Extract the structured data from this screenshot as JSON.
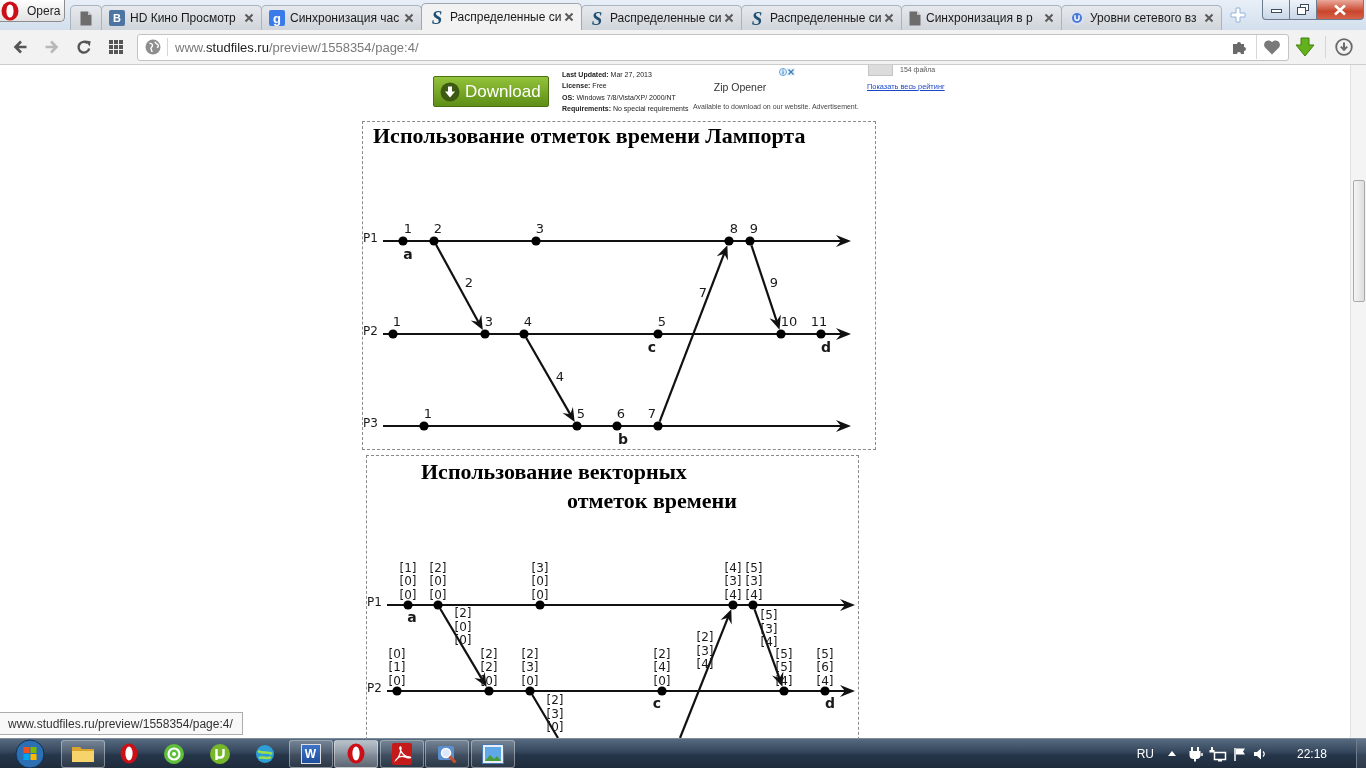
{
  "browser": {
    "menu_button": {
      "label": "Opera"
    },
    "tabs": [
      {
        "selected": false
      },
      {
        "favicon": "B",
        "title": "HD Кино Просмотр",
        "selected": false
      },
      {
        "favicon": "g",
        "title": "Синхронизация час",
        "selected": false
      },
      {
        "favicon": "S",
        "title": "Распределенные си",
        "selected": true
      },
      {
        "favicon": "S",
        "title": "Распределенные си",
        "selected": false
      },
      {
        "favicon": "S",
        "title": "Распределенные си",
        "selected": false
      },
      {
        "title": "Синхронизация в р",
        "selected": false
      },
      {
        "title": "Уровни сетевого вз",
        "selected": false
      }
    ],
    "navigation": {
      "back_disabled": false,
      "forward_disabled": true
    },
    "address": {
      "prefix": "www.",
      "domain": "studfiles.ru",
      "path": "/preview/1558354/page:4/"
    }
  },
  "page": {
    "ad": {
      "button": "Download",
      "details": [
        "**Last Updated:** Mar 27, 2013",
        "**License:** Free",
        "**OS:** Windows 7/8/Vista/XP/ 2000/NT",
        "**Requirements:** No special requirements"
      ],
      "title": "Zip Opener",
      "disclaimer": "Available to download on our website. Advertisement."
    },
    "sidebar": {
      "count": "154 файла",
      "link": "Показать весь рейтинг"
    },
    "slides": [
      {
        "title": [
          "Использование отметок времени Лампорта"
        ],
        "diagram": {
          "processes": [
            {
              "name": "P1",
              "events": [
                {
                  "timestamp": [
                    "1"
                  ],
                  "label": "a"
                },
                {
                  "timestamp": [
                    "2"
                  ]
                },
                {
                  "timestamp": [
                    "3"
                  ]
                },
                {
                  "timestamp": [
                    "8"
                  ]
                },
                {
                  "timestamp": [
                    "9"
                  ]
                }
              ]
            },
            {
              "name": "P2",
              "events": [
                {
                  "timestamp": [
                    "1"
                  ]
                },
                {
                  "timestamp": [
                    "3"
                  ]
                },
                {
                  "timestamp": [
                    "4"
                  ]
                },
                {
                  "timestamp": [
                    "5"
                  ],
                  "label": "c"
                },
                {
                  "timestamp": [
                    "10"
                  ]
                },
                {
                  "timestamp": [
                    "11"
                  ],
                  "label": "d"
                }
              ]
            },
            {
              "name": "P3",
              "events": [
                {
                  "timestamp": [
                    "1"
                  ]
                },
                {
                  "timestamp": [
                    "5"
                  ]
                },
                {
                  "timestamp": [
                    "6"
                  ],
                  "label": "b"
                },
                {
                  "timestamp": [
                    "7"
                  ]
                }
              ]
            }
          ],
          "messages": [
            {
              "timestamp": [
                "2"
              ]
            },
            {
              "timestamp": [
                "4"
              ]
            },
            {
              "timestamp": [
                "7"
              ]
            },
            {
              "timestamp": [
                "9"
              ]
            }
          ]
        }
      },
      {
        "title": [
          "Использование векторных",
          "отметок времени"
        ],
        "diagram": {
          "processes": [
            {
              "name": "P1",
              "events": [
                {
                  "timestamp": [
                    "[1]",
                    "[0]",
                    "[0]"
                  ],
                  "label": "a"
                },
                {
                  "timestamp": [
                    "[2]",
                    "[0]",
                    "[0]"
                  ]
                },
                {
                  "timestamp": [
                    "[3]",
                    "[0]",
                    "[0]"
                  ]
                },
                {
                  "timestamp": [
                    "[4]",
                    "[3]",
                    "[4]"
                  ]
                },
                {
                  "timestamp": [
                    "[5]",
                    "[3]",
                    "[4]"
                  ]
                }
              ]
            },
            {
              "name": "P2",
              "events": [
                {
                  "timestamp": [
                    "[0]",
                    "[1]",
                    "[0]"
                  ]
                },
                {
                  "timestamp": [
                    "[2]",
                    "[2]",
                    "[0]"
                  ]
                },
                {
                  "timestamp": [
                    "[2]",
                    "[3]",
                    "[0]"
                  ]
                },
                {
                  "timestamp": [
                    "[2]",
                    "[4]",
                    "[0]"
                  ],
                  "label": "c"
                },
                {
                  "timestamp": [
                    "[5]",
                    "[5]",
                    "[4]"
                  ]
                },
                {
                  "timestamp": [
                    "[5]",
                    "[6]",
                    "[4]"
                  ],
                  "label": "d"
                }
              ]
            }
          ],
          "messages": [
            {
              "timestamp": [
                "[2]",
                "[0]",
                "[0]"
              ]
            },
            {
              "timestamp": [
                "[2]",
                "[3]",
                "[0]"
              ]
            },
            {
              "timestamp": [
                "[2]",
                "[3]",
                "[4]"
              ]
            },
            {
              "timestamp": [
                "[5]",
                "[3]",
                "[4]"
              ]
            }
          ]
        }
      }
    ]
  },
  "status_url": "www.studfiles.ru/preview/1558354/page:4/",
  "taskbar": {
    "apps": [
      {
        "running": true,
        "selected": false
      },
      {
        "running": false,
        "selected": false
      },
      {
        "running": false,
        "selected": false
      },
      {
        "running": false,
        "selected": false
      },
      {
        "running": false,
        "selected": false
      },
      {
        "letter": "W",
        "running": true,
        "selected": false
      },
      {
        "running": true,
        "selected": true
      },
      {
        "running": true,
        "selected": false
      },
      {
        "running": true,
        "selected": false
      },
      {
        "running": true,
        "selected": false
      }
    ],
    "language": "RU",
    "time": "22:18"
  }
}
